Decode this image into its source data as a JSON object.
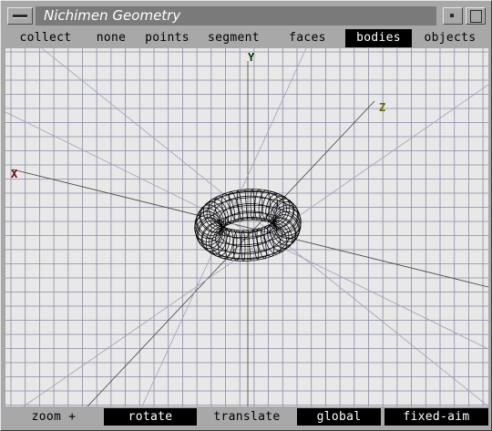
{
  "window": {
    "title": "Nichimen Geometry"
  },
  "menubar": {
    "items": [
      {
        "label": "collect",
        "active": false
      },
      {
        "label": "none",
        "active": false
      },
      {
        "label": "points",
        "active": false
      },
      {
        "label": "segment",
        "active": false
      },
      {
        "label": "faces",
        "active": false
      },
      {
        "label": "bodies",
        "active": true
      },
      {
        "label": "objects",
        "active": false
      }
    ]
  },
  "viewport": {
    "axes": {
      "x": "X",
      "y": "Y",
      "z": "Z"
    },
    "colors": {
      "background": "#e8e8e8",
      "grid": "#8a8aa6",
      "axis": "#404040",
      "x": "#6a0000",
      "y": "#004000",
      "z": "#6a6a00",
      "mesh": "#000000"
    }
  },
  "bottombar": {
    "items": [
      {
        "label": "zoom +",
        "active": false
      },
      {
        "label": "rotate",
        "active": true
      },
      {
        "label": "translate",
        "active": false
      },
      {
        "label": "global",
        "active": true
      },
      {
        "label": "fixed-aim",
        "active": true
      }
    ]
  }
}
